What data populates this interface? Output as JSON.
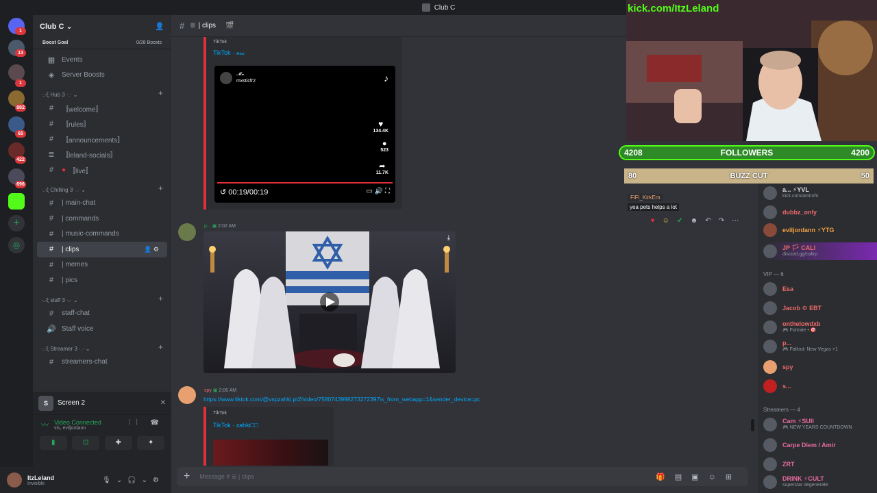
{
  "window": {
    "title": "Club C"
  },
  "rail": {
    "badges": [
      "1",
      "13",
      "1",
      "882",
      "65",
      "422",
      "696"
    ]
  },
  "server": {
    "name": "Club C",
    "boost_label": "Boost Goal",
    "boost_count": "0/28 Boosts"
  },
  "sidebar": {
    "top_items": [
      {
        "label": "Events"
      },
      {
        "label": "Server Boosts"
      }
    ],
    "categories": [
      {
        "label": "·.·ξ Hub 3 ·.· ⌄",
        "channels": [
          "〚welcome〛",
          "〚rules〛",
          "〚announcements〛",
          "〚leland-socials〛",
          "〚live〛"
        ]
      },
      {
        "label": "·.·ξ Chilling 3 ·.· ⌄",
        "channels": [
          "| main-chat",
          "| commands",
          "| music-commands",
          "| clips",
          "| memes",
          "| pics"
        ]
      },
      {
        "label": "·.·ξ staff 3 ·.· ⌄",
        "channels": [
          "staff-chat",
          "Staff voice"
        ]
      },
      {
        "label": "·.·ξ Streamer 3 ·.· ⌄",
        "channels": [
          "streamers-chat"
        ]
      }
    ]
  },
  "voice": {
    "screen_label": "Screen 2",
    "screen_letter": "S",
    "status": "Video Connected",
    "status_sub": "vis, eviljordann"
  },
  "user": {
    "name": "ItzLeland",
    "status": "Invisible"
  },
  "channel": {
    "name": "| clips"
  },
  "messages": {
    "embed1": {
      "provider": "TikTok",
      "title": "TikTok · 𝓂𝔁",
      "author_display": "𝓜𝔁",
      "author_handle": "mxsticfr2",
      "likes": "134.4K",
      "comments": "523",
      "shares": "11.7K",
      "time": "00:19/00:19"
    },
    "msg2": {
      "author": "p...",
      "time": "2:02 AM"
    },
    "msg3": {
      "author": "spy",
      "time": "2:06 AM",
      "link": "https://www.tiktok.com/@vspzahki.pt2/video/7580743998273272397is_from_webapp=1&sender_device=pc",
      "embed_provider": "TikTok",
      "embed_title": "TikTok · zahki□□"
    }
  },
  "composer": {
    "placeholder": "Message # ≣ | clips"
  },
  "overlay": {
    "kick_text": "kick.com/ItzLeland",
    "followers_left": "4208",
    "followers_label": "FOLLOWERS",
    "followers_right": "4200",
    "goal_left": "80",
    "goal_label": "BUZZ CUT",
    "goal_right": "50",
    "chat_name": "FiFi_KirkEm",
    "chat_text": "yea pets helps a lot"
  },
  "members": {
    "top": [
      {
        "name": "a... ⚡YVL",
        "sub": "kick.com/amirofn",
        "color": "#dbdee1"
      },
      {
        "name": "dubbz_only",
        "sub": "",
        "color": "#f06a6a"
      },
      {
        "name": "eviljordann ⚡YTG",
        "sub": "",
        "color": "#f2a040"
      },
      {
        "name": "JP 🏳 CALI",
        "sub": "discord.gg/calirp",
        "color": "#f06a6a"
      }
    ],
    "vip_header": "VIP — 6",
    "vip": [
      {
        "name": "Esa",
        "sub": "",
        "color": "#f06a6a"
      },
      {
        "name": "Jacob ⚙ EBT",
        "sub": "",
        "color": "#f06a6a"
      },
      {
        "name": "onthelowdxb",
        "sub": "🎮 Fortnite • 🎯",
        "color": "#f06a6a"
      },
      {
        "name": "p...",
        "sub": "🎮 Fallout: New Vegas +1",
        "color": "#f06a6a"
      },
      {
        "name": "spy",
        "sub": "",
        "color": "#f06a6a"
      },
      {
        "name": "s...",
        "sub": "",
        "color": "#f06a6a"
      }
    ],
    "streamers_header": "Streamers — 4",
    "streamers": [
      {
        "name": "Cam ⚡SUII",
        "sub": "🎮 NEW YEARS COUNTDOWN",
        "color": "#e86aa0"
      },
      {
        "name": "Carpe Diem / Amir",
        "sub": "",
        "color": "#e86aa0"
      },
      {
        "name": "ZRT",
        "sub": "",
        "color": "#e86aa0"
      },
      {
        "name": "DRINK ⚡CULT",
        "sub": "superstar degenerate",
        "color": "#e86aa0"
      }
    ]
  }
}
